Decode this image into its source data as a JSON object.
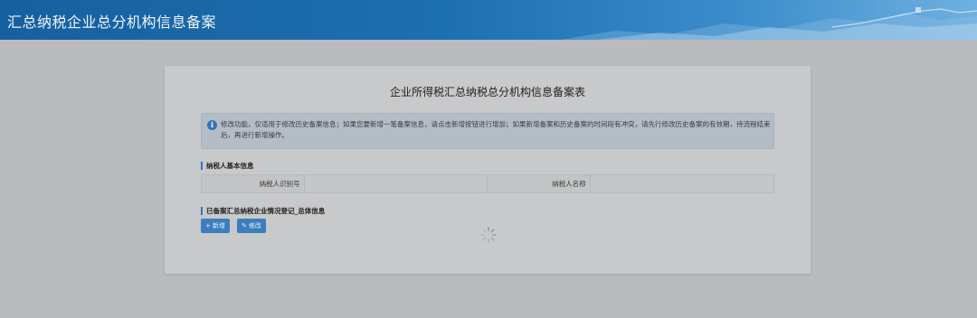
{
  "header": {
    "title": "汇总纳税企业总分机构信息备案"
  },
  "form": {
    "title": "企业所得税汇总纳税总分机构信息备案表",
    "notice": "修改功能，仅适用于修改历史备案信息；如果您要新增一笔备案信息，请点击新增按钮进行增加；如果新增备案和历史备案的时间段有冲突，请先行修改历史备案的有效期，待流程结束后，再进行新增操作。",
    "section_basic": "纳税人基本信息",
    "taxpayer_id_label": "纳税人识别号",
    "taxpayer_id_value": "",
    "taxpayer_name_label": "纳税人名称",
    "taxpayer_name_value": "",
    "section_registered": "已备案汇总纳税企业情况登记_总体信息",
    "add_label": "新增",
    "edit_label": "修改"
  },
  "colors": {
    "accent": "#2f74bb",
    "header": "#1c6fb0"
  },
  "icons": {
    "notice": "info-icon",
    "add": "plus-icon",
    "edit": "pencil-icon",
    "loading": "loading-spinner-icon"
  }
}
